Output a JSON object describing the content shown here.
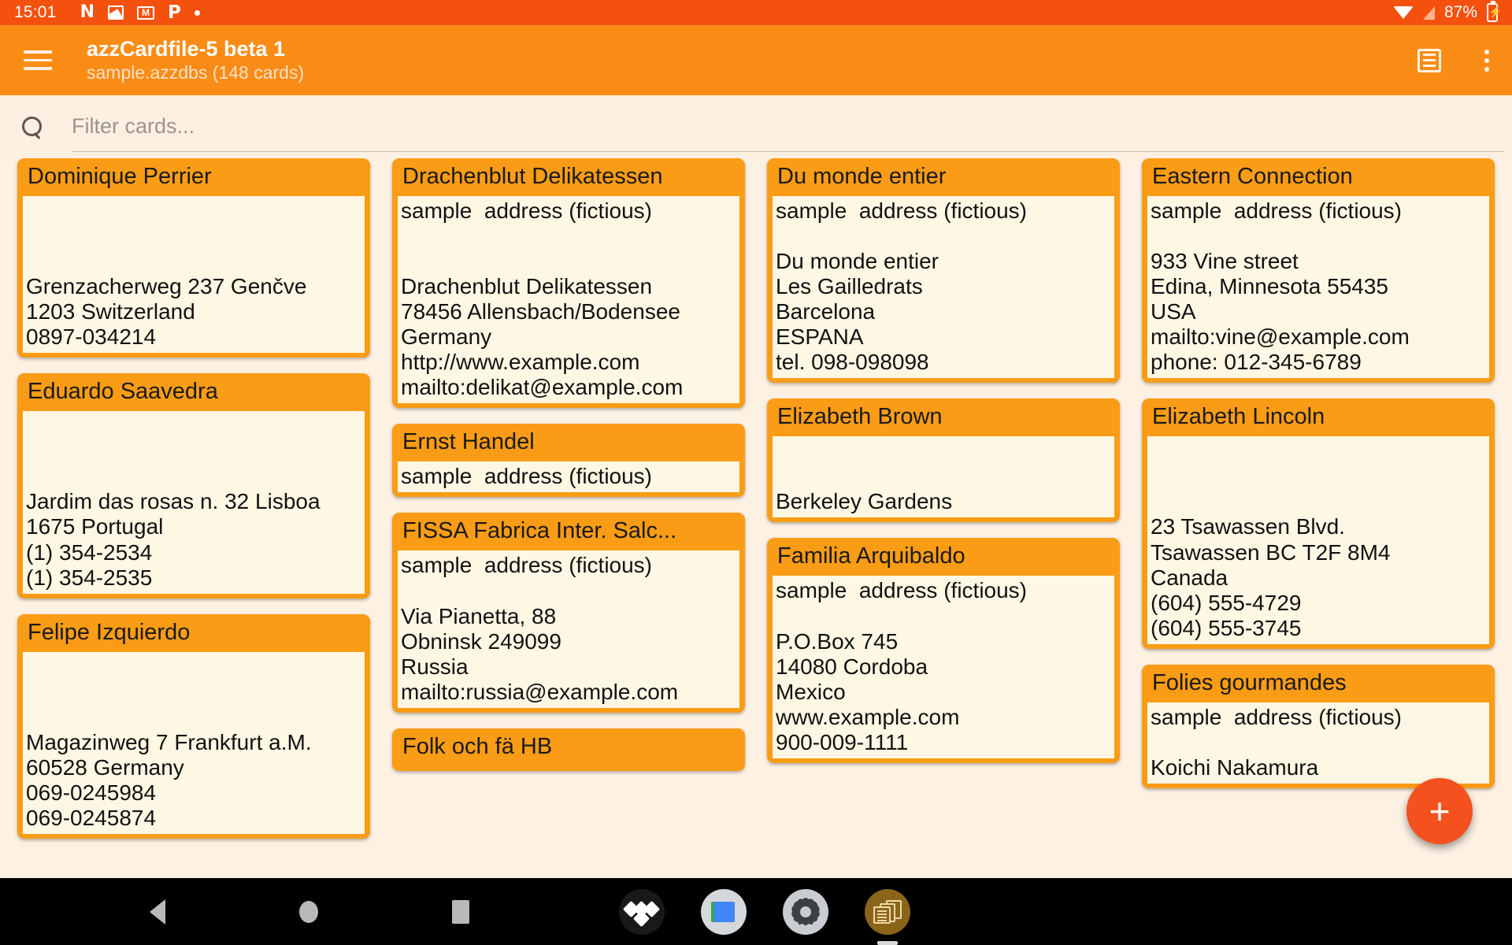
{
  "status_bar": {
    "clock": "15:01",
    "battery_percent": "87%",
    "notification_icons": [
      "netflix-icon",
      "photo-icon",
      "gmail-icon",
      "pandora-icon",
      "dot-icon"
    ],
    "right_icons": [
      "wifi-icon",
      "cell-signal-icon",
      "battery-charging-icon"
    ]
  },
  "app_bar": {
    "title": "azzCardfile-5 beta 1",
    "subtitle": "sample.azzdbs (148 cards)",
    "menu_icon": "hamburger-icon",
    "view_icon": "list-view-icon",
    "overflow_icon": "kebab-menu-icon"
  },
  "search": {
    "icon": "search-icon",
    "value": "",
    "placeholder": "Filter cards..."
  },
  "fab": {
    "label": "+",
    "icon": "plus-icon",
    "color": "#f4511e"
  },
  "colors": {
    "status_bar": "#f4510e",
    "app_bar": "#fa8c16",
    "card_header": "#fa9c15",
    "card_body": "#fdf7e3",
    "page_background": "#fdf1e4",
    "accent": "#f4511e"
  },
  "columns": [
    {
      "cards": [
        {
          "title": "Dominique Perrier",
          "body": "\n\n\nGrenzacherweg 237 Genčve\n1203 Switzerland\n0897-034214"
        },
        {
          "title": "Eduardo Saavedra",
          "body": "\n\n\nJardim das rosas n. 32 Lisboa\n1675 Portugal\n(1) 354-2534\n(1) 354-2535"
        },
        {
          "title": "Felipe Izquierdo",
          "body": "\n\n\nMagazinweg 7 Frankfurt a.M.\n60528 Germany\n069-0245984\n069-0245874"
        }
      ]
    },
    {
      "cards": [
        {
          "title": "Drachenblut Delikatessen",
          "body": "sample  address (fictious)\n\n\nDrachenblut Delikatessen\n78456 Allensbach/Bodensee\nGermany\nhttp://www.example.com\nmailto:delikat@example.com"
        },
        {
          "title": "Ernst Handel",
          "body": "sample  address (fictious)"
        },
        {
          "title": "FISSA Fabrica Inter. Salc...",
          "body": "sample  address (fictious)\n\nVia Pianetta, 88\nObninsk 249099\nRussia\nmailto:russia@example.com"
        },
        {
          "title": "Folk och fä HB",
          "body": ""
        }
      ]
    },
    {
      "cards": [
        {
          "title": "Du monde entier",
          "body": "sample  address (fictious)\n\nDu monde entier\nLes Gailledrats\nBarcelona\nESPANA\ntel. 098-098098"
        },
        {
          "title": "Elizabeth Brown",
          "body": "\n\nBerkeley Gardens"
        },
        {
          "title": "Familia Arquibaldo",
          "body": "sample  address (fictious)\n\nP.O.Box 745\n14080 Cordoba\nMexico\nwww.example.com\n900-009-1111"
        }
      ]
    },
    {
      "cards": [
        {
          "title": "Eastern Connection",
          "body": "sample  address (fictious)\n\n933 Vine street\nEdina, Minnesota 55435\nUSA\nmailto:vine@example.com\nphone: 012-345-6789"
        },
        {
          "title": "Elizabeth Lincoln",
          "body": "\n\n\n23 Tsawassen Blvd.\nTsawassen BC T2F 8M4\nCanada\n(604) 555-4729\n(604) 555-3745"
        },
        {
          "title": "Folies gourmandes",
          "body": "sample  address (fictious)\n\nKoichi Nakamura"
        }
      ]
    }
  ],
  "nav_bar": {
    "system_buttons": [
      "back-icon",
      "home-icon",
      "recents-icon"
    ],
    "app_shortcuts": [
      "tidal-app-icon",
      "files-app-icon",
      "settings-app-icon",
      "cardfile-app-icon"
    ]
  }
}
